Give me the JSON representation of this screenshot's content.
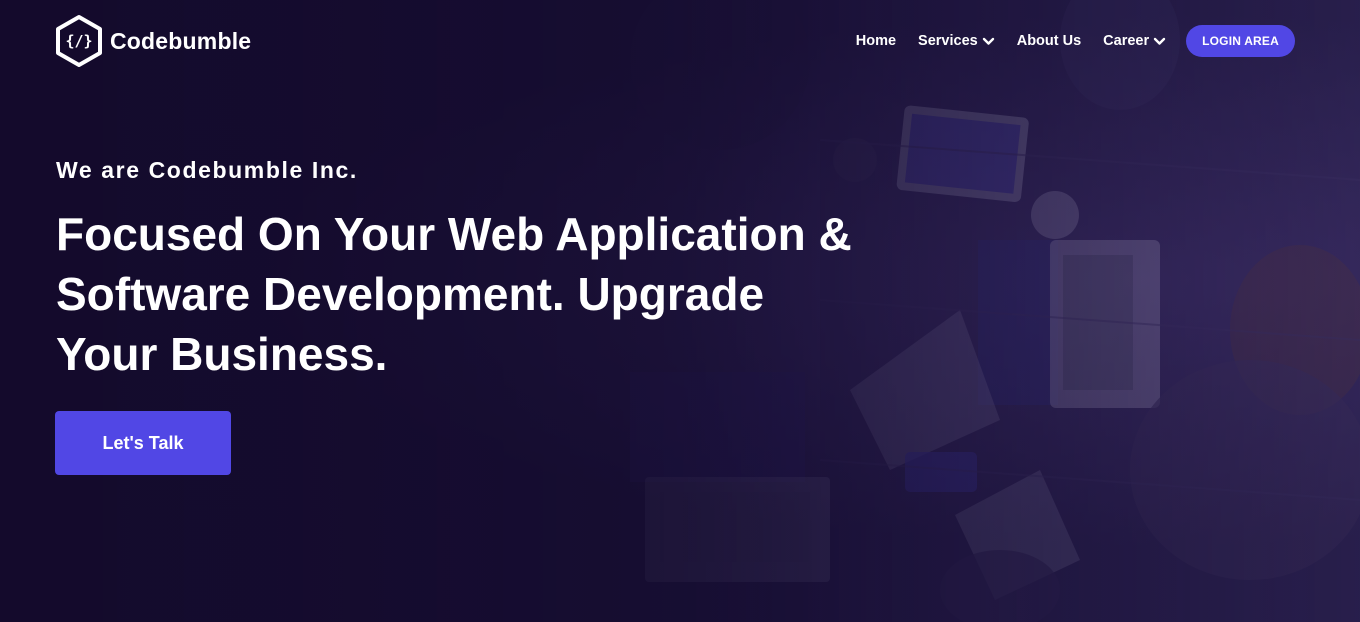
{
  "brand": {
    "name": "Codebumble",
    "logo_icon": "code-hexagon-icon",
    "colors": {
      "background": "#150d2e",
      "accent": "#5147e5",
      "text": "#ffffff"
    }
  },
  "nav": {
    "items": [
      {
        "label": "Home",
        "has_dropdown": false
      },
      {
        "label": "Services",
        "has_dropdown": true
      },
      {
        "label": "About Us",
        "has_dropdown": false
      },
      {
        "label": "Career",
        "has_dropdown": true
      }
    ],
    "login_label": "LOGIN AREA"
  },
  "hero": {
    "eyebrow": "We are Codebumble Inc.",
    "headline_lines": [
      "Focused On Your Web Application &",
      "Software Development. Upgrade",
      "Your Business."
    ],
    "cta_label": "Let's Talk"
  }
}
